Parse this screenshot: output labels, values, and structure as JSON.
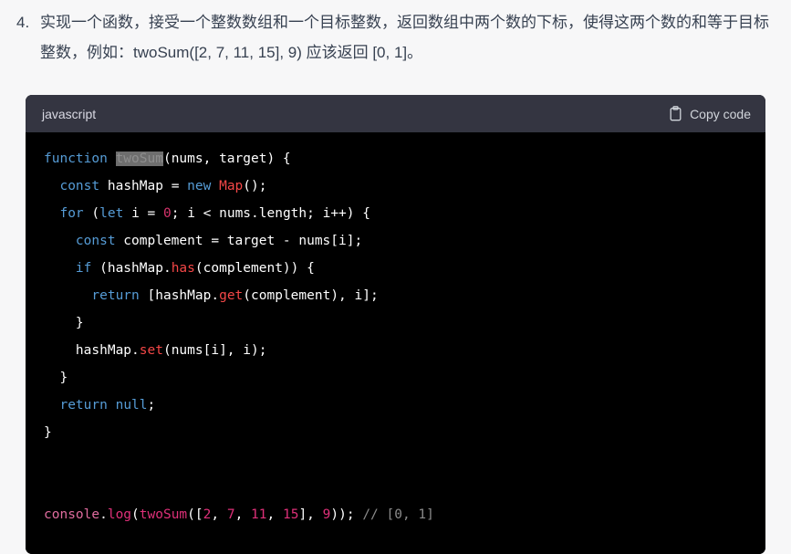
{
  "paragraph": {
    "marker": "4.",
    "text": "实现一个函数，接受一个整数数组和一个目标整数，返回数组中两个数的下标，使得这两个数的和等于目标整数，例如：twoSum([2, 7, 11, 15], 9) 应该返回 [0, 1]。",
    "text_color": "#374151"
  },
  "code_block": {
    "language": "javascript",
    "copy_label": "Copy code",
    "copy_icon": "clipboard-icon",
    "header_bg": "#343541",
    "body_bg": "#000000",
    "selection_text": "twoSum",
    "lines": [
      {
        "indent": 0,
        "tokens": [
          {
            "text": "function",
            "type": "kw"
          },
          {
            "text": " ",
            "type": "plain"
          },
          {
            "text": "twoSum",
            "type": "sel"
          },
          {
            "text": "(nums, target) {",
            "type": "plain"
          }
        ]
      },
      {
        "indent": 1,
        "tokens": [
          {
            "text": "const",
            "type": "kw"
          },
          {
            "text": " hashMap = ",
            "type": "plain"
          },
          {
            "text": "new",
            "type": "kw"
          },
          {
            "text": " ",
            "type": "plain"
          },
          {
            "text": "Map",
            "type": "cls"
          },
          {
            "text": "();",
            "type": "plain"
          }
        ]
      },
      {
        "indent": 1,
        "tokens": [
          {
            "text": "for",
            "type": "kw"
          },
          {
            "text": " (",
            "type": "plain"
          },
          {
            "text": "let",
            "type": "kw"
          },
          {
            "text": " i = ",
            "type": "plain"
          },
          {
            "text": "0",
            "type": "num"
          },
          {
            "text": "; i < nums.length; i++) {",
            "type": "plain"
          }
        ]
      },
      {
        "indent": 2,
        "tokens": [
          {
            "text": "const",
            "type": "kw"
          },
          {
            "text": " complement = target - nums[i];",
            "type": "plain"
          }
        ]
      },
      {
        "indent": 2,
        "tokens": [
          {
            "text": "if",
            "type": "kw"
          },
          {
            "text": " (hashMap.",
            "type": "plain"
          },
          {
            "text": "has",
            "type": "fn"
          },
          {
            "text": "(complement)) {",
            "type": "plain"
          }
        ]
      },
      {
        "indent": 3,
        "tokens": [
          {
            "text": "return",
            "type": "kw"
          },
          {
            "text": " [hashMap.",
            "type": "plain"
          },
          {
            "text": "get",
            "type": "fn"
          },
          {
            "text": "(complement), i];",
            "type": "plain"
          }
        ]
      },
      {
        "indent": 2,
        "tokens": [
          {
            "text": "}",
            "type": "plain"
          }
        ]
      },
      {
        "indent": 2,
        "tokens": [
          {
            "text": "hashMap.",
            "type": "plain"
          },
          {
            "text": "set",
            "type": "fn"
          },
          {
            "text": "(nums[i], i);",
            "type": "plain"
          }
        ]
      },
      {
        "indent": 1,
        "tokens": [
          {
            "text": "}",
            "type": "plain"
          }
        ]
      },
      {
        "indent": 1,
        "tokens": [
          {
            "text": "return",
            "type": "kw"
          },
          {
            "text": " ",
            "type": "plain"
          },
          {
            "text": "null",
            "type": "kw"
          },
          {
            "text": ";",
            "type": "plain"
          }
        ]
      },
      {
        "indent": 0,
        "tokens": [
          {
            "text": "}",
            "type": "plain"
          }
        ]
      },
      {
        "indent": 0,
        "blank": true,
        "tokens": []
      },
      {
        "indent": 0,
        "blank": true,
        "tokens": []
      },
      {
        "indent": 0,
        "tokens": [
          {
            "text": "console",
            "type": "obj"
          },
          {
            "text": ".",
            "type": "plain"
          },
          {
            "text": "log",
            "type": "mem"
          },
          {
            "text": "(",
            "type": "plain"
          },
          {
            "text": "twoSum",
            "type": "mem"
          },
          {
            "text": "([",
            "type": "plain"
          },
          {
            "text": "2",
            "type": "numlt"
          },
          {
            "text": ", ",
            "type": "plain"
          },
          {
            "text": "7",
            "type": "numlt"
          },
          {
            "text": ", ",
            "type": "plain"
          },
          {
            "text": "11",
            "type": "numlt"
          },
          {
            "text": ", ",
            "type": "plain"
          },
          {
            "text": "15",
            "type": "numlt"
          },
          {
            "text": "], ",
            "type": "plain"
          },
          {
            "text": "9",
            "type": "numlt"
          },
          {
            "text": "));",
            "type": "plain"
          },
          {
            "text": " ",
            "type": "plain"
          },
          {
            "text": "// [0, 1]",
            "type": "cmt"
          }
        ]
      }
    ]
  }
}
